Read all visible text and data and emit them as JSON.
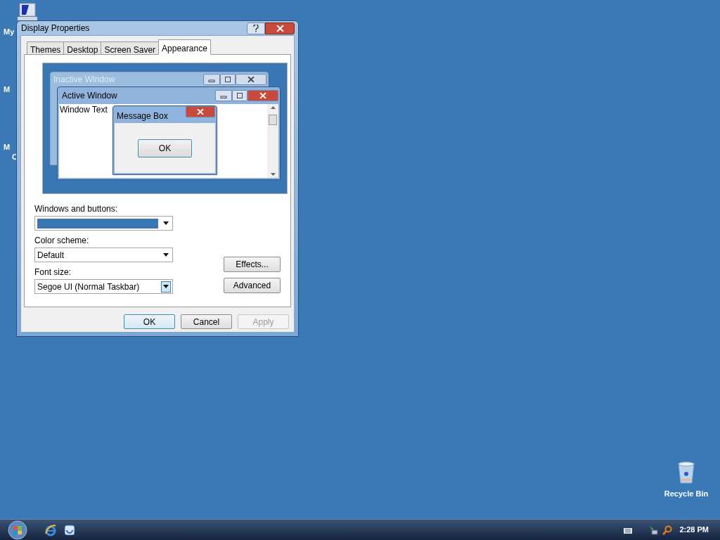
{
  "desktop_icons": [
    {
      "lines": [
        "My"
      ]
    },
    {
      "lines": [
        "M"
      ]
    },
    {
      "lines": [
        "M",
        "C"
      ]
    }
  ],
  "recycle_bin": {
    "label": "Recycle Bin"
  },
  "dialog": {
    "title": "Display Properties",
    "tabs": [
      {
        "label": "Themes",
        "selected": false
      },
      {
        "label": "Desktop",
        "selected": false
      },
      {
        "label": "Screen Saver",
        "selected": false
      },
      {
        "label": "Appearance",
        "selected": true
      }
    ],
    "preview": {
      "inactive_title": "Inactive Window",
      "active_title": "Active Window",
      "window_text": "Window Text",
      "message_title": "Message Box",
      "message_button": "OK"
    },
    "fields": [
      {
        "label": "Windows and buttons:",
        "kind": "swatch",
        "color": "#3a75b4"
      },
      {
        "label": "Color scheme:",
        "kind": "text",
        "value": "Default"
      },
      {
        "label": "Font size:",
        "kind": "text",
        "value": "Segoe UI (Normal Taskbar)",
        "hovered": true
      }
    ],
    "side_buttons": [
      "Effects...",
      "Advanced"
    ],
    "footer_buttons": [
      {
        "label": "OK",
        "default": true,
        "disabled": false
      },
      {
        "label": "Cancel",
        "default": false,
        "disabled": false
      },
      {
        "label": "Apply",
        "default": false,
        "disabled": true
      }
    ]
  },
  "taskbar": {
    "clock": "2:28 PM"
  }
}
